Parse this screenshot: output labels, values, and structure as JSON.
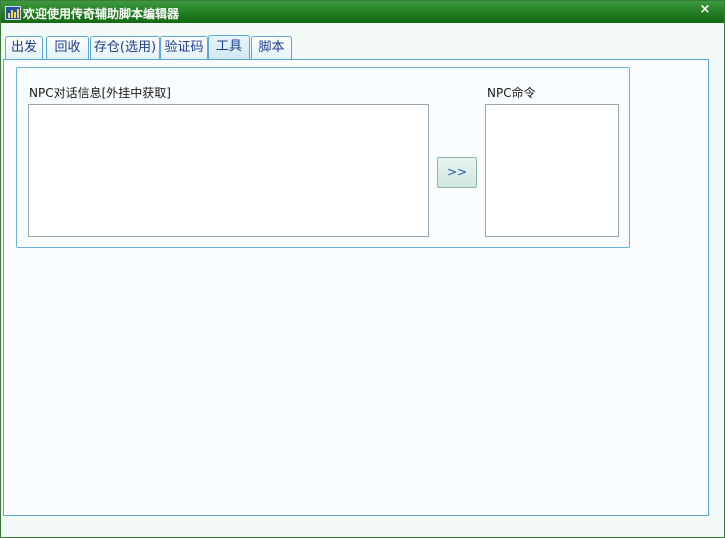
{
  "window": {
    "title": "欢迎使用传奇辅助脚本编辑器",
    "close_symbol": "×"
  },
  "tabs": [
    {
      "label": "出发"
    },
    {
      "label": "回收"
    },
    {
      "label": "存仓(选用)"
    },
    {
      "label": "验证码"
    },
    {
      "label": "工具",
      "active": true
    },
    {
      "label": "脚本"
    }
  ],
  "tool_panel": {
    "npc_dialog_label": "NPC对话信息[外挂中获取]",
    "npc_dialog_value": "",
    "npc_command_label": "NPC命令",
    "npc_command_value": "",
    "transfer_button_label": ">>"
  },
  "icons": {
    "app": "app-icon",
    "close": "close-icon",
    "scroll_up": "scroll-up-arrow-icon",
    "scroll_down": "scroll-down-arrow-icon"
  },
  "colors": {
    "titlebar": "#1f7a1f",
    "tab_border": "#5aa7d8",
    "tab_text": "#1c3d8a",
    "button_bg": "#d8eee4"
  }
}
